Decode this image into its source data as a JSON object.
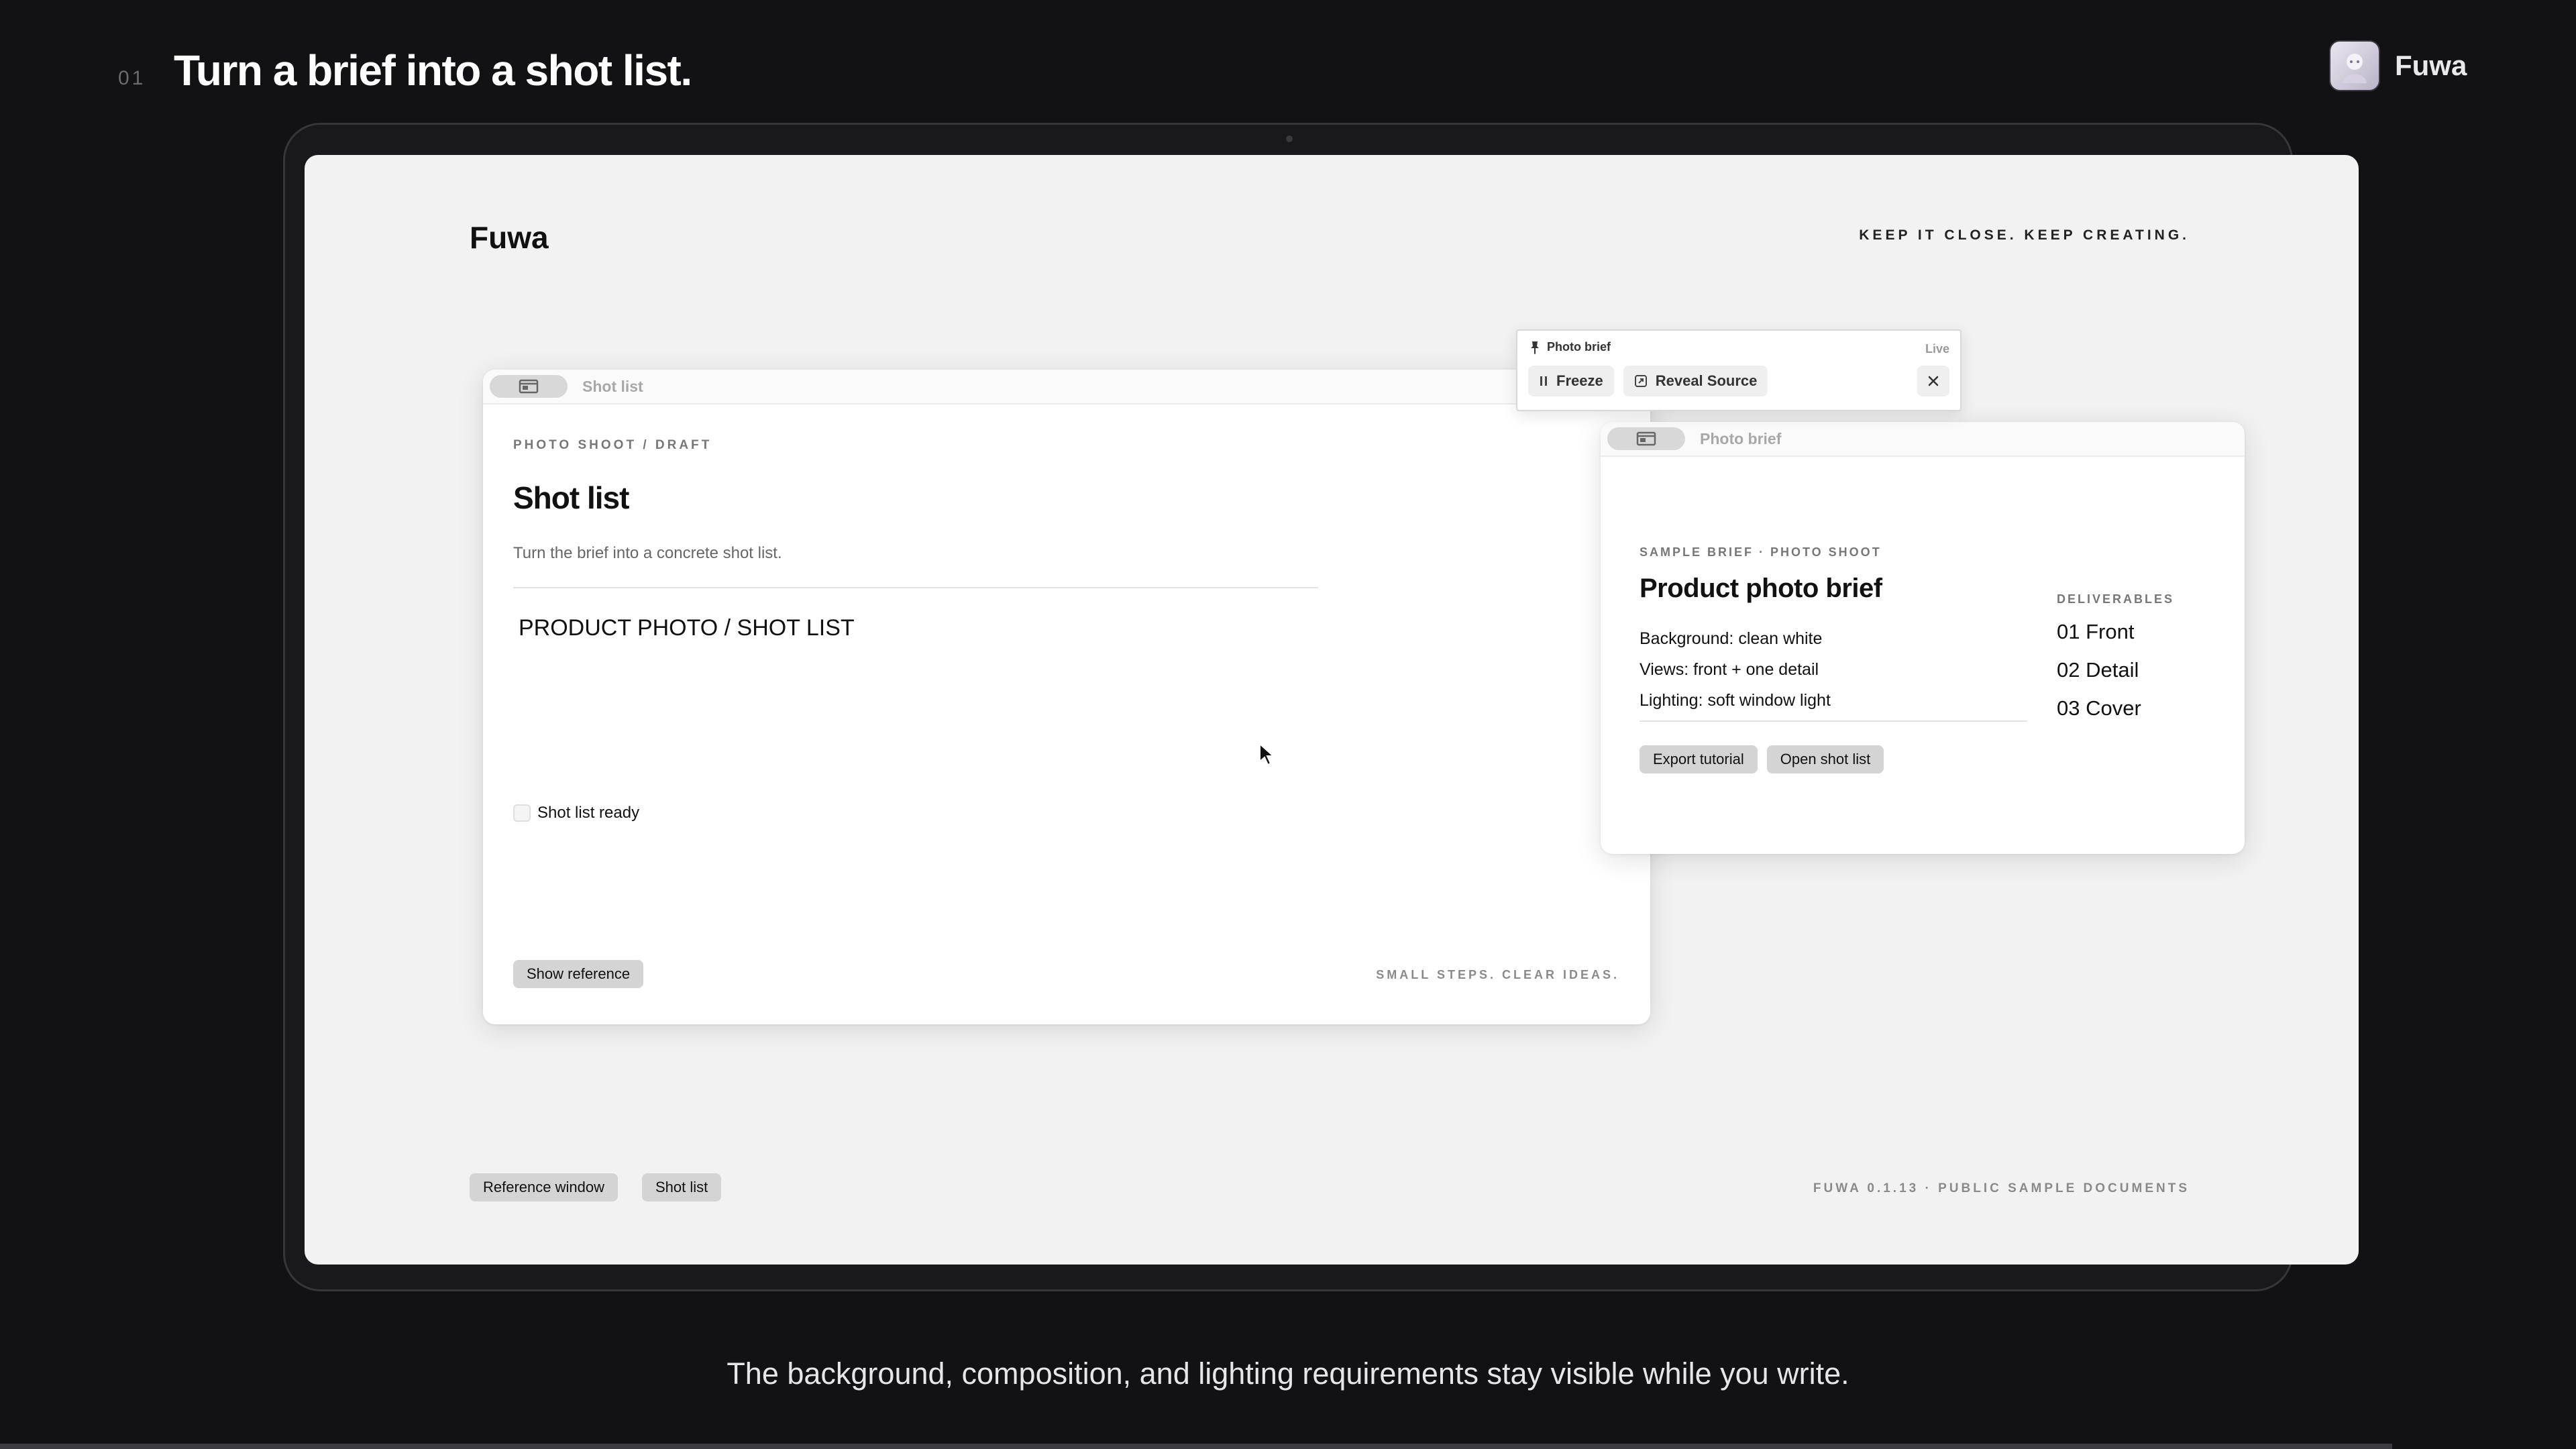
{
  "slide": {
    "number": "01",
    "title": "Turn a brief into a shot list.",
    "brand_name": "Fuwa",
    "caption": "The background, composition, and lighting requirements stay visible while you write."
  },
  "app": {
    "logo": "Fuwa",
    "tagline": "KEEP IT CLOSE. KEEP CREATING.",
    "version": "FUWA 0.1.13 · PUBLIC SAMPLE DOCUMENTS",
    "bottom_tabs": [
      "Reference window",
      "Shot list"
    ]
  },
  "shot_list_window": {
    "title": "Shot list",
    "breadcrumb": "PHOTO SHOOT / DRAFT",
    "heading": "Shot list",
    "description": "Turn the brief into a concrete shot list.",
    "editor_text": "PRODUCT PHOTO / SHOT LIST",
    "checkbox_label": "Shot list ready",
    "show_reference_label": "Show reference",
    "footer": "SMALL STEPS. CLEAR IDEAS."
  },
  "brief_window": {
    "title": "Photo brief",
    "eyebrow": "SAMPLE BRIEF · PHOTO SHOOT",
    "heading": "Product photo brief",
    "requirements": [
      "Background: clean white",
      "Views: front + one detail",
      "Lighting: soft window light"
    ],
    "export_label": "Export tutorial",
    "open_label": "Open shot list",
    "deliverables_label": "DELIVERABLES",
    "deliverables": [
      "01 Front",
      "02 Detail",
      "03 Cover"
    ]
  },
  "popover": {
    "title": "Photo brief",
    "status": "Live",
    "freeze_label": "Freeze",
    "reveal_label": "Reveal Source"
  },
  "icons": {
    "pin": "pin-icon",
    "pause": "pause-icon",
    "reveal": "reveal-source-icon",
    "close": "close-icon",
    "window": "window-icon",
    "cursor": "mouse-cursor-icon"
  }
}
